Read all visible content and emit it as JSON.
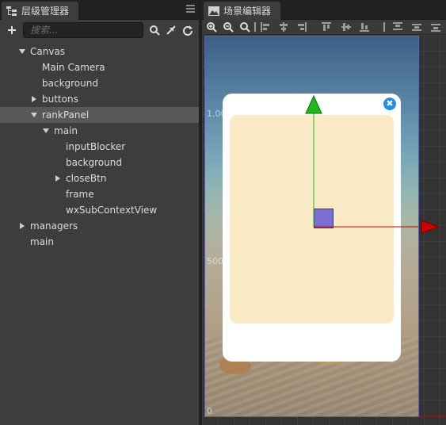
{
  "hierarchy": {
    "tab_label": "层级管理器",
    "search_placeholder": "搜索...",
    "tree": [
      {
        "label": "Canvas",
        "depth": 0,
        "arrow": "down"
      },
      {
        "label": "Main Camera",
        "depth": 1,
        "arrow": "none"
      },
      {
        "label": "background",
        "depth": 1,
        "arrow": "none"
      },
      {
        "label": "buttons",
        "depth": 1,
        "arrow": "right"
      },
      {
        "label": "rankPanel",
        "depth": 1,
        "arrow": "down",
        "selected": true
      },
      {
        "label": "main",
        "depth": 2,
        "arrow": "down"
      },
      {
        "label": "inputBlocker",
        "depth": 3,
        "arrow": "none"
      },
      {
        "label": "background",
        "depth": 3,
        "arrow": "none"
      },
      {
        "label": "closeBtn",
        "depth": 3,
        "arrow": "right"
      },
      {
        "label": "frame",
        "depth": 3,
        "arrow": "none"
      },
      {
        "label": "wxSubContextView",
        "depth": 3,
        "arrow": "none"
      },
      {
        "label": "managers",
        "depth": 0,
        "arrow": "right"
      },
      {
        "label": "main",
        "depth": 0,
        "arrow": "none"
      }
    ]
  },
  "scene": {
    "tab_label": "场景编辑器",
    "ruler": {
      "top": "1,000",
      "mid": "500",
      "bottom": "0"
    },
    "close_glyph": "✖"
  },
  "colors": {
    "selection": "#585858",
    "gizmo_x": "#cc0000",
    "gizmo_y": "#1eb81e",
    "canvas_border": "#5a5ae0",
    "close_button": "#1e8ee6"
  }
}
